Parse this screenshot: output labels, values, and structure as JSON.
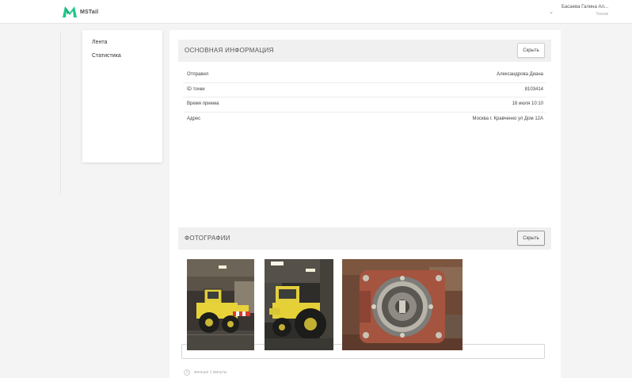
{
  "header": {
    "logo_text": "MSTail",
    "user_name": "Басаева Галина Ал...",
    "user_role": "Техник"
  },
  "sidebar": {
    "items": [
      {
        "label": "Лента"
      },
      {
        "label": "Статистика"
      }
    ]
  },
  "info_section": {
    "title": "ОСНОВНАЯ ИНФОРМАЦИЯ",
    "hide_label": "Скрыть",
    "rows": [
      {
        "label": "Отправил",
        "value": "Александрова Диана"
      },
      {
        "label": "ID точки",
        "value": "8103414"
      },
      {
        "label": "Время приема",
        "value": "18 июля 10:10"
      },
      {
        "label": "Адрес",
        "value": "Москва г. Кравченко ул Дом 12А"
      }
    ]
  },
  "photos_section": {
    "title": "ФОТОГРАФИИ",
    "hide_label": "Скрыть",
    "photos": [
      {
        "subject": "yellow-tractor-photo"
      },
      {
        "subject": "yellow-tractor-photo"
      },
      {
        "subject": "engine-part-photo"
      }
    ]
  },
  "comment": {
    "value": "",
    "placeholder": ""
  },
  "footer": {
    "time_text": "меньше 1 минуты"
  },
  "colors": {
    "brand_green": "#1fc98b",
    "tractor_yellow": "#e8d23a",
    "part_red": "#a5543f"
  }
}
